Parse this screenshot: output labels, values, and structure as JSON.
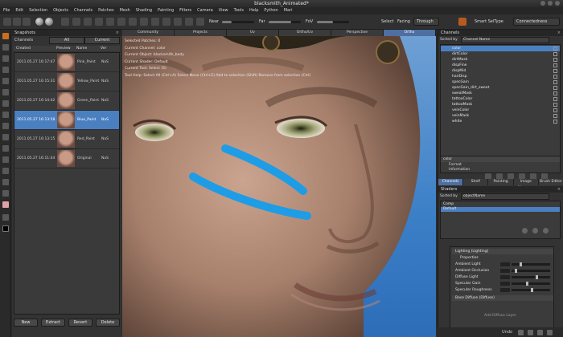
{
  "window": {
    "title": "blacksmith_Animated*"
  },
  "menu": [
    "File",
    "Edit",
    "Selection",
    "Objects",
    "Channels",
    "Patches",
    "Mesh",
    "Shading",
    "Painting",
    "Filters",
    "Camera",
    "View",
    "Tools",
    "Help",
    "Python",
    "Mari"
  ],
  "toolbar": {
    "near_label": "Near",
    "far_label": "Far",
    "fov_label": "FoV",
    "select_label": "Select",
    "facing_label": "Facing",
    "through_value": "Through",
    "smart_sel_label": "Smart SelType",
    "connectedness_value": "Connectedness"
  },
  "snapshots": {
    "title": "Snapshots",
    "channels_label": "Channels",
    "all_label": "All",
    "current_label": "Current",
    "columns": [
      "Created",
      "Preview",
      "Name",
      "Ver"
    ],
    "rows": [
      {
        "date": "2011.05.27 16:17:47",
        "name": "Pink_Paint",
        "ver": "NaS"
      },
      {
        "date": "2011.05.27 16:15:31",
        "name": "Yellow_Paint",
        "ver": "NaS"
      },
      {
        "date": "2011.05.27 16:14:42",
        "name": "Green_Paint",
        "ver": "NaS"
      },
      {
        "date": "2011.05.27 16:13:58",
        "name": "Blue_Paint",
        "ver": "NaS",
        "selected": true
      },
      {
        "date": "2011.05.27 16:13:15",
        "name": "Red_Paint",
        "ver": "NaS"
      },
      {
        "date": "2011.05.27 16:11:44",
        "name": "Original",
        "ver": "NaS"
      }
    ],
    "buttons": {
      "new": "New",
      "extract": "Extract",
      "revert": "Revert",
      "delete": "Delete"
    }
  },
  "viewport": {
    "tabs": [
      "Community",
      "Projects",
      "Uv",
      "Ortho/Uv",
      "Perspective",
      "Ortho"
    ],
    "active_tab": "Ortho",
    "hud": [
      "Selected Patches: 0",
      "Current Channel: color",
      "Current Object: blacksmith_body",
      "Current Shader: Default",
      "Current Tool: Select (S)",
      "Tool Help: Select All (Ctrl+A)   Select None (Ctrl+E)   Add to selection (Shift)   Remove from selection (Ctrl)"
    ]
  },
  "channels_panel": {
    "title": "Channels",
    "sorted_label": "Sorted by",
    "sorted_value": "Channel Name",
    "items": [
      "color",
      "dirtColor",
      "dirtMask",
      "dispFine",
      "dispMid",
      "hairDisp",
      "specGain",
      "specGain_dirt_sweat",
      "sweatMask",
      "tattooColor",
      "tattooMask",
      "veinColor",
      "veinMask",
      "white"
    ],
    "props_header": "color",
    "props_rows": [
      "Format",
      "Information"
    ]
  },
  "right_tabs": [
    "Channels",
    "Shelf",
    "Painting",
    "Image Manager",
    "Brush Editor"
  ],
  "shaders_panel": {
    "title": "Shaders",
    "sorted_label": "Sorted by",
    "sorted_value": "objectName",
    "items": [
      "Comp",
      "Default"
    ],
    "lighting_header": "Lighting (Lighting)",
    "properties_label": "Properties",
    "rows": [
      "Ambient Light",
      "Ambient Occlusion",
      "Diffuse Light",
      "Specular Gain",
      "Specular Roughness"
    ],
    "diffuse_header": "Base Diffuse (Diffuse)",
    "add_label": "Add Diffuse Layer"
  },
  "status": {
    "undo_label": "Undo"
  },
  "colors": {
    "accent": "#4a7fc0",
    "paint": "#1f9ce6",
    "tool_active": "#c8701e"
  }
}
